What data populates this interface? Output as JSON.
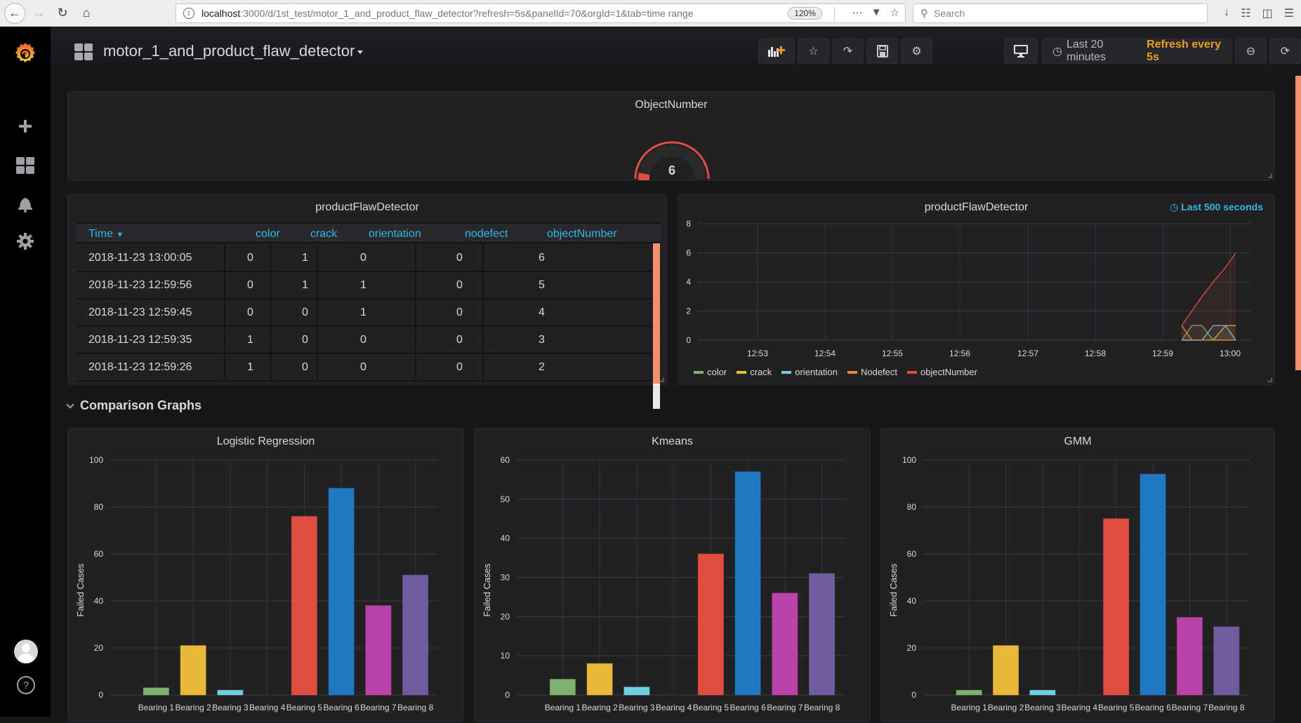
{
  "browser": {
    "url_host": "localhost",
    "url_rest": ":3000/d/1st_test/motor_1_and_product_flaw_detector?refresh=5s&panelId=70&orgId=1&tab=time range",
    "zoom_level": "120%",
    "search_placeholder": "Search"
  },
  "navbar": {
    "dashboard_title": "motor_1_and_product_flaw_detector",
    "time_range": "Last 20 minutes",
    "refresh": "Refresh every 5s"
  },
  "gauge_panel": {
    "title": "ObjectNumber",
    "value": "6",
    "color": "#e24d42"
  },
  "table_panel": {
    "title": "productFlawDetector",
    "columns": [
      "Time",
      "color",
      "crack",
      "orientation",
      "nodefect",
      "objectNumber"
    ],
    "sort_indicator": "desc",
    "rows": [
      [
        "2018-11-23 13:00:05",
        "0",
        "1",
        "0",
        "0",
        "6"
      ],
      [
        "2018-11-23 12:59:56",
        "0",
        "1",
        "1",
        "0",
        "5"
      ],
      [
        "2018-11-23 12:59:45",
        "0",
        "0",
        "1",
        "0",
        "4"
      ],
      [
        "2018-11-23 12:59:35",
        "1",
        "0",
        "0",
        "0",
        "3"
      ],
      [
        "2018-11-23 12:59:26",
        "1",
        "0",
        "0",
        "0",
        "2"
      ]
    ]
  },
  "row_header": {
    "title": "Comparison Graphs"
  },
  "chart_data": [
    {
      "id": "flaw-timeseries",
      "type": "line",
      "title": "productFlawDetector",
      "time_info": "Last 500 seconds",
      "x": [
        "12:59:17",
        "12:59:26",
        "12:59:35",
        "12:59:45",
        "12:59:56",
        "13:00:05"
      ],
      "x_ticks": [
        "12:53",
        "12:54",
        "12:55",
        "12:56",
        "12:57",
        "12:58",
        "12:59",
        "13:00"
      ],
      "ylim": [
        0,
        8
      ],
      "y_ticks": [
        0,
        2,
        4,
        6,
        8
      ],
      "grid": true,
      "legend": "bottom-left",
      "series": [
        {
          "name": "color",
          "color": "#7eb26d",
          "values": [
            0,
            1,
            1,
            0,
            0,
            0
          ]
        },
        {
          "name": "crack",
          "color": "#eab839",
          "values": [
            0,
            0,
            0,
            0,
            1,
            1
          ]
        },
        {
          "name": "orientation",
          "color": "#6ed0e0",
          "values": [
            0,
            0,
            0,
            1,
            1,
            0
          ]
        },
        {
          "name": "Nodefect",
          "color": "#ef843c",
          "values": [
            1,
            0,
            0,
            0,
            0,
            0
          ]
        },
        {
          "name": "objectNumber",
          "color": "#e24d42",
          "values": [
            1,
            2,
            3,
            4,
            5,
            6
          ]
        }
      ]
    },
    {
      "id": "logistic-regression",
      "type": "bar",
      "title": "Logistic Regression",
      "ylabel": "Failed Cases",
      "xlabel": "",
      "categories": [
        "Bearing 1",
        "Bearing 2",
        "Bearing 3",
        "Bearing 4",
        "Bearing 5",
        "Bearing 6",
        "Bearing 7",
        "Bearing 8"
      ],
      "values": [
        3,
        21,
        2,
        0,
        76,
        88,
        38,
        51
      ],
      "ylim": [
        0,
        100
      ],
      "y_ticks": [
        0,
        20,
        40,
        60,
        80,
        100
      ],
      "colors": [
        "#7eb26d",
        "#eab839",
        "#6ed0e0",
        "#ef843c",
        "#e24d42",
        "#1f78c1",
        "#ba43a9",
        "#705da0"
      ],
      "grid": true
    },
    {
      "id": "kmeans",
      "type": "bar",
      "title": "Kmeans",
      "ylabel": "Failed Cases",
      "xlabel": "",
      "categories": [
        "Bearing 1",
        "Bearing 2",
        "Bearing 3",
        "Bearing 4",
        "Bearing 5",
        "Bearing 6",
        "Bearing 7",
        "Bearing 8"
      ],
      "values": [
        4,
        8,
        2,
        0,
        36,
        57,
        26,
        31
      ],
      "ylim": [
        0,
        60
      ],
      "y_ticks": [
        0,
        10,
        20,
        30,
        40,
        50,
        60
      ],
      "colors": [
        "#7eb26d",
        "#eab839",
        "#6ed0e0",
        "#ef843c",
        "#e24d42",
        "#1f78c1",
        "#ba43a9",
        "#705da0"
      ],
      "grid": true
    },
    {
      "id": "gmm",
      "type": "bar",
      "title": "GMM",
      "ylabel": "Failed Cases",
      "xlabel": "",
      "categories": [
        "Bearing 1",
        "Bearing 2",
        "Bearing 3",
        "Bearing 4",
        "Bearing 5",
        "Bearing 6",
        "Bearing 7",
        "Bearing 8"
      ],
      "values": [
        2,
        21,
        2,
        0,
        75,
        94,
        33,
        29
      ],
      "ylim": [
        0,
        100
      ],
      "y_ticks": [
        0,
        20,
        40,
        60,
        80,
        100
      ],
      "colors": [
        "#7eb26d",
        "#eab839",
        "#6ed0e0",
        "#ef843c",
        "#e24d42",
        "#1f78c1",
        "#ba43a9",
        "#705da0"
      ],
      "grid": true
    }
  ]
}
